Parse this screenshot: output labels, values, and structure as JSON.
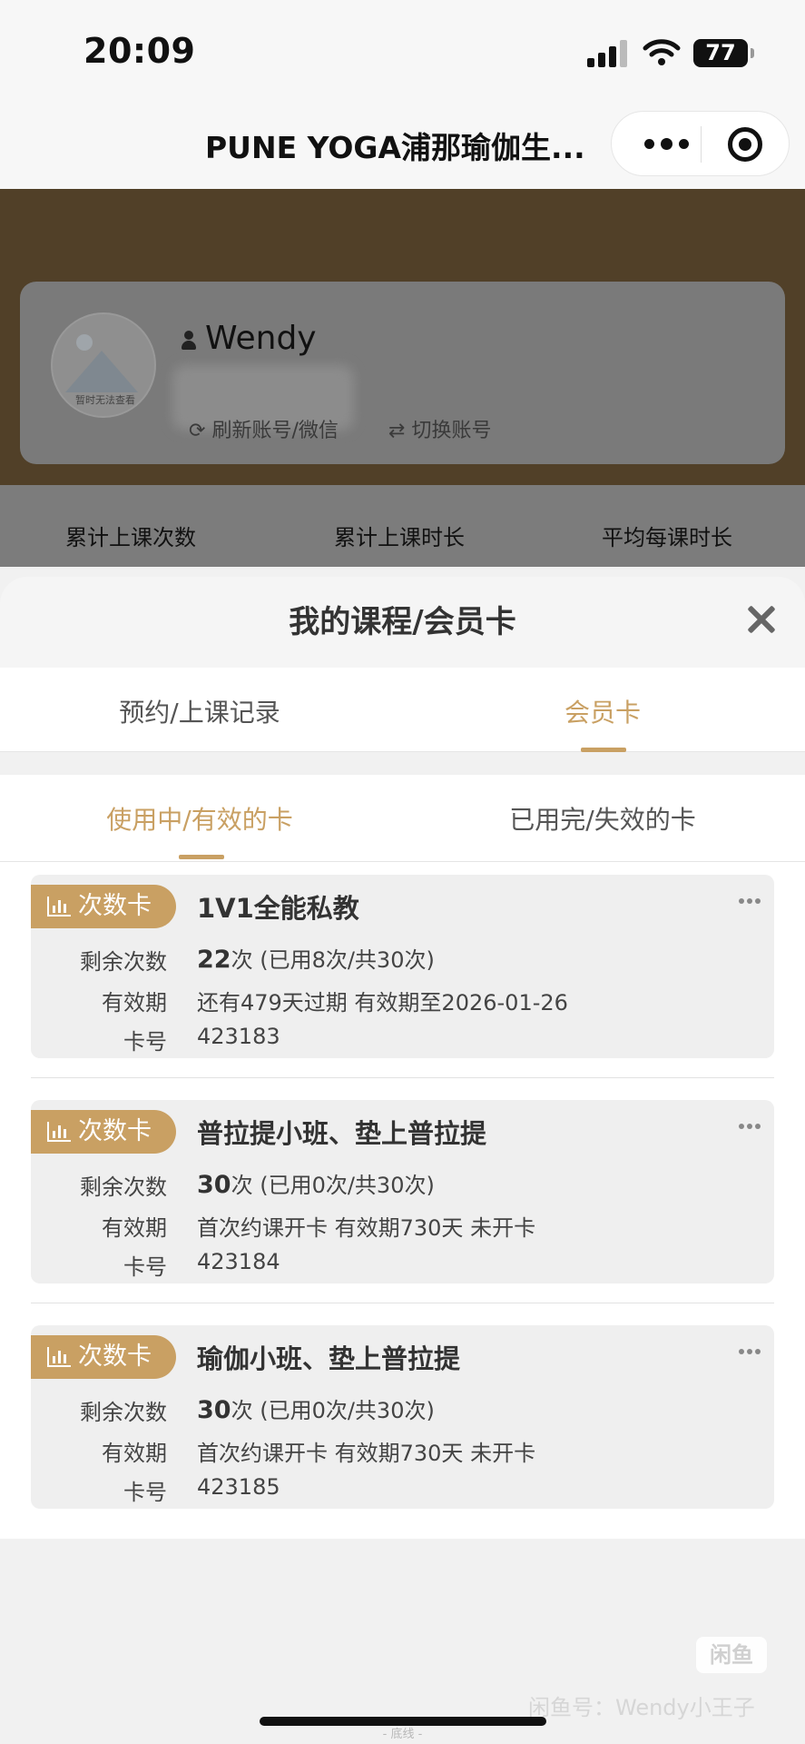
{
  "status_bar": {
    "time": "20:09",
    "battery": "77"
  },
  "navbar": {
    "title": "PUNE YOGA浦那瑜伽生..."
  },
  "profile": {
    "avatar_caption": "暂时无法查看",
    "name": "Wendy",
    "refresh_label": "刷新账号/微信",
    "switch_label": "切换账号"
  },
  "stats": [
    "累计上课次数",
    "累计上课时长",
    "平均每课时长"
  ],
  "sheet": {
    "title": "我的课程/会员卡",
    "tabs": [
      "预约/上课记录",
      "会员卡"
    ],
    "active_tab": 1,
    "subtabs": [
      "使用中/有效的卡",
      "已用完/失效的卡"
    ],
    "active_subtab": 0
  },
  "labels": {
    "remaining": "剩余次数",
    "validity": "有效期",
    "card_no": "卡号"
  },
  "cards": [
    {
      "badge": "次数卡",
      "name": "1V1全能私教",
      "remaining_count": "22",
      "remaining_unit": "次",
      "remaining_detail": " (已用8次/共30次)",
      "validity": "还有479天过期 有效期至2026-01-26",
      "card_no": "423183"
    },
    {
      "badge": "次数卡",
      "name": "普拉提小班、垫上普拉提",
      "remaining_count": "30",
      "remaining_unit": "次",
      "remaining_detail": " (已用0次/共30次)",
      "validity": "首次约课开卡 有效期730天 未开卡",
      "card_no": "423184"
    },
    {
      "badge": "次数卡",
      "name": "瑜伽小班、垫上普拉提",
      "remaining_count": "30",
      "remaining_unit": "次",
      "remaining_detail": " (已用0次/共30次)",
      "validity": "首次约课开卡 有效期730天 未开卡",
      "card_no": "423185"
    }
  ],
  "watermark": {
    "logo": "闲鱼",
    "text": "闲鱼号：Wendy小王子"
  },
  "footer_text": "- 底线 -",
  "colors": {
    "accent": "#c9a063",
    "hero": "#514028"
  }
}
